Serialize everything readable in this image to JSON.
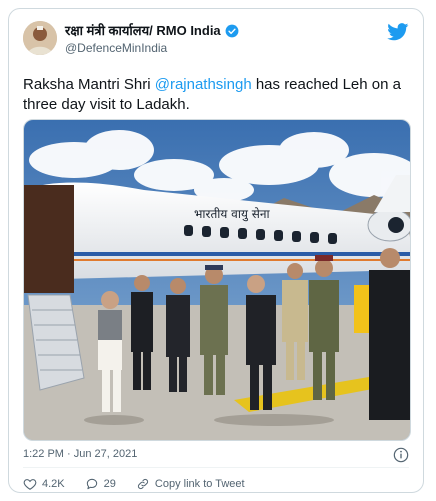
{
  "author": {
    "display_name": "रक्षा मंत्री कार्यालय/ RMO India",
    "handle": "@DefenceMinIndia",
    "verified": true,
    "avatar_icon": "person-avatar"
  },
  "tweet": {
    "text_prefix": "Raksha Mantri Shri ",
    "mention": "@rajnathsingh",
    "text_suffix": " has reached Leh on a three day visit to Ladakh."
  },
  "media": {
    "aircraft_lettering": "भारतीय वायु सेना"
  },
  "meta": {
    "timestamp": "1:22 PM · Jun 27, 2021"
  },
  "actions": {
    "likes": "4.2K",
    "replies": "29",
    "copy_link_label": "Copy link to Tweet"
  },
  "colors": {
    "accent": "#1d9bf0",
    "like": "#f91880",
    "text_secondary": "#536471"
  }
}
